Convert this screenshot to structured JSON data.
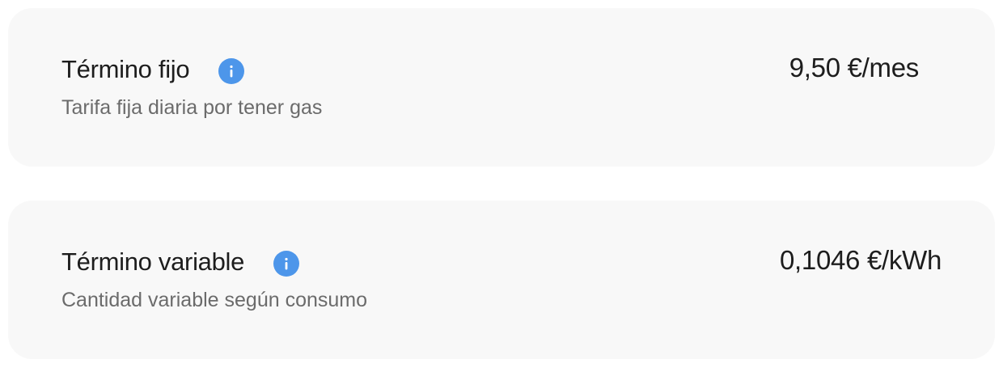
{
  "items": [
    {
      "title": "Término fijo",
      "description": "Tarifa fija diaria por tener gas",
      "price": "9,50 €/mes",
      "icon": "info-icon"
    },
    {
      "title": "Término variable",
      "description": "Cantidad variable según consumo",
      "price": "0,1046 €/kWh",
      "icon": "info-icon"
    }
  ],
  "colors": {
    "card_background": "#f8f8f8",
    "info_icon": "#4d96ea",
    "title_text": "#1d1d1d",
    "description_text": "#6b6b6b"
  }
}
